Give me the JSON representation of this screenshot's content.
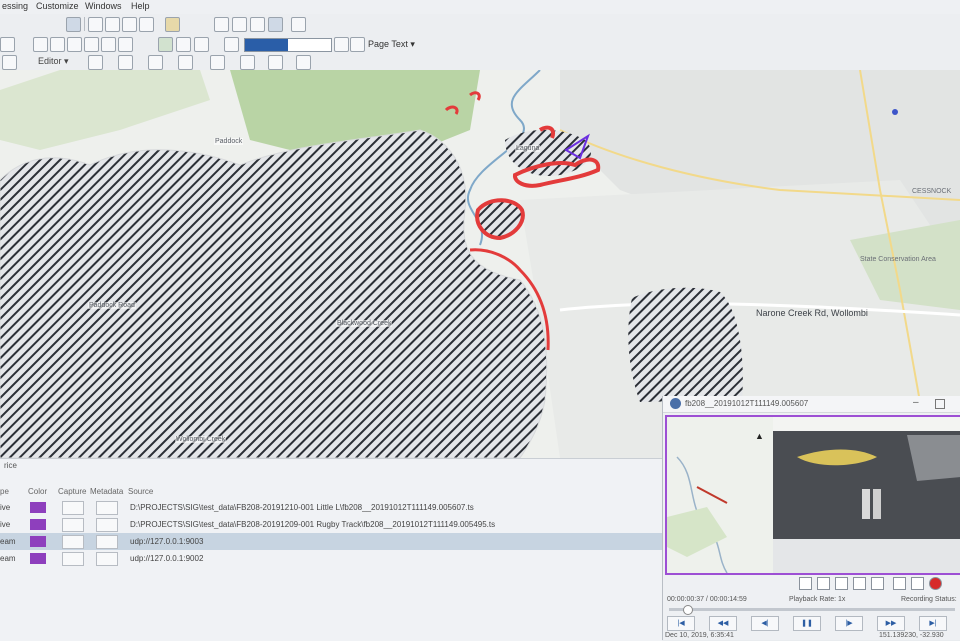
{
  "app": {
    "menu": [
      "essing",
      "Customize",
      "Windows",
      "Help"
    ]
  },
  "toolbar": {
    "page_text": "Page Text ▾",
    "editor_label": "Editor ▾",
    "progress": 0.5
  },
  "map": {
    "labels": {
      "paddock": "Paddock",
      "creek": "Blackwood Creek",
      "west_road": "Paddock Road",
      "south": "Wollombi Creek",
      "town_north": "Laguna",
      "cessnock": "CESSNOCK",
      "conservation": "State Conservation Area",
      "road": "Narone Creek Rd, Wollombi"
    }
  },
  "panel": {
    "title": "rice",
    "columns": [
      "pe",
      "Color",
      "Capture",
      "Metadata",
      "Source"
    ],
    "rows": [
      {
        "type": "ive",
        "source": "D:\\PROJECTS\\SIG\\test_data\\FB208-20191210-001 Little L\\fb208__20191012T111149.005607.ts"
      },
      {
        "type": "ive",
        "source": "D:\\PROJECTS\\SIG\\test_data\\FB208-20191209-001 Rugby Track\\fb208__20191012T111149.005495.ts"
      },
      {
        "type": "eam",
        "source": "udp://127.0.0.1:9003"
      },
      {
        "type": "eam",
        "source": "udp://127.0.0.1:9002"
      }
    ]
  },
  "video": {
    "title": "fb208__20191012T111149.005607",
    "time": "00:00:00:37 / 00:00:14:59",
    "rate": "Playback Rate: 1x",
    "recording": "Recording Status:",
    "date": "Dec 10, 2019, 6:35:41",
    "coord": "151.139230, -32.930",
    "controls": [
      "|◀",
      "◀◀",
      "◀|",
      "❚❚",
      "|▶",
      "▶▶",
      "▶|"
    ],
    "accent": "#9d4fd4"
  },
  "colors": {
    "fire_perimeter": "#e33b3b",
    "burn_hatch": "#2b2f36",
    "vegetation": "#b9d4a5",
    "swatch": "#8e3fbd"
  }
}
